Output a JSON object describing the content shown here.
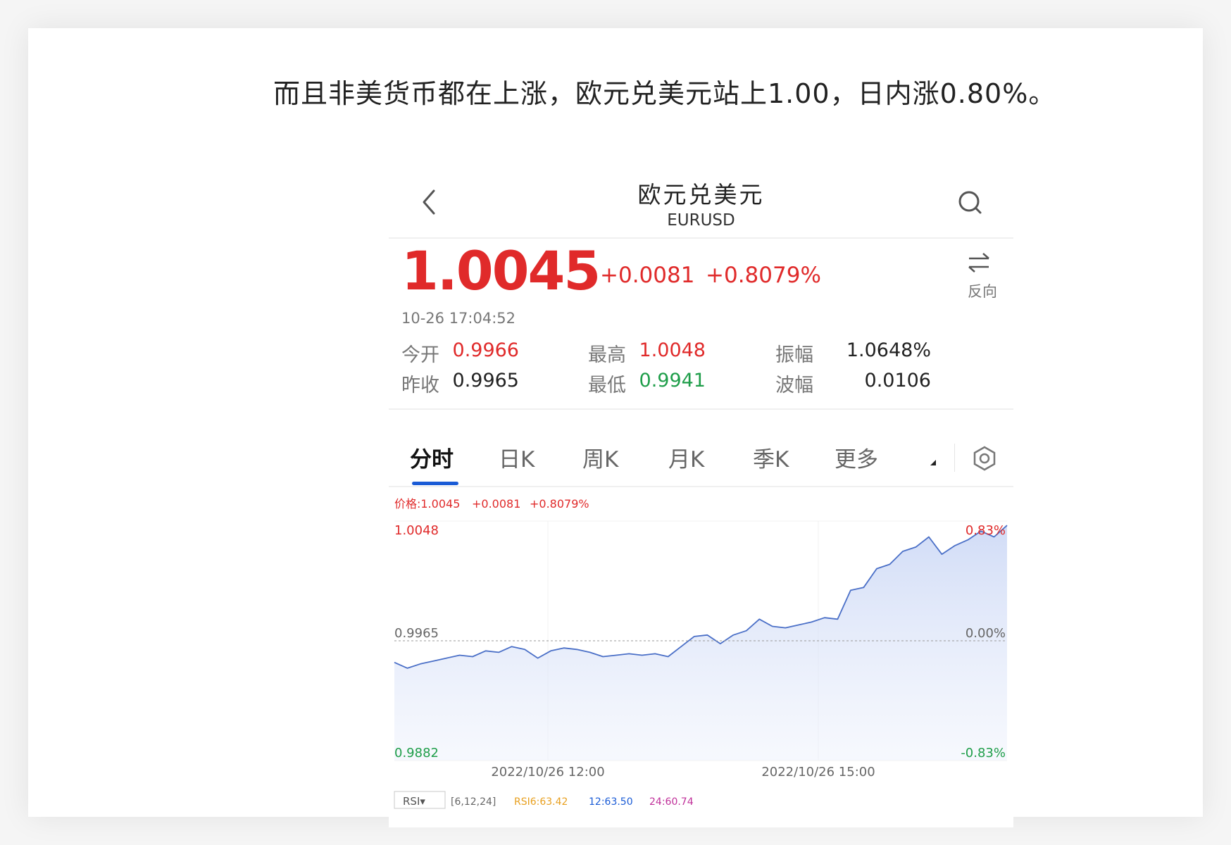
{
  "caption": "而且非美货币都在上涨，欧元兑美元站上1.00，日内涨0.80%。",
  "header": {
    "title": "欧元兑美元",
    "subtitle": "EURUSD"
  },
  "quote": {
    "price": "1.0045",
    "change": "+0.0081",
    "change_pct": "+0.8079%",
    "timestamp": "10-26 17:04:52",
    "reverse_label": "反向"
  },
  "stats": {
    "open_label": "今开",
    "open": "0.9966",
    "high_label": "最高",
    "high": "1.0048",
    "amplitude_label": "振幅",
    "amplitude": "1.0648%",
    "prev_close_label": "昨收",
    "prev_close": "0.9965",
    "low_label": "最低",
    "low": "0.9941",
    "range_label": "波幅",
    "range": "0.0106"
  },
  "tabs": [
    {
      "label": "分时",
      "active": true
    },
    {
      "label": "日K"
    },
    {
      "label": "周K"
    },
    {
      "label": "月K"
    },
    {
      "label": "季K"
    },
    {
      "label": "更多"
    }
  ],
  "colors": {
    "up": "#e02a2a",
    "down": "#1f9e4a",
    "line": "#4a6fc7",
    "accent": "#1a5bd6"
  },
  "chart": {
    "info_price": "价格:1.0045",
    "info_change": "+0.0081",
    "info_pct": "+0.8079%",
    "y_top": "1.0048",
    "y_mid": "0.9965",
    "y_bot": "0.9882",
    "pct_top": "0.83%",
    "pct_mid": "0.00%",
    "pct_bot": "-0.83%",
    "x_label_1": "2022/10/26 12:00",
    "x_label_2": "2022/10/26 15:00",
    "rsi_label": "RSI▾",
    "rsi_params": "[6,12,24]",
    "rsi_6": "RSI6:63.42",
    "rsi_12": "12:63.50",
    "rsi_24": "24:60.74"
  },
  "chart_data": {
    "type": "line",
    "title": "",
    "xlabel": "",
    "ylabel": "",
    "x_ticks": [
      "2022/10/26 12:00",
      "2022/10/26 15:00"
    ],
    "ylim": [
      0.9882,
      1.0048
    ],
    "reference": 0.9965,
    "series": [
      {
        "values": [
          0.995,
          0.9946,
          0.9949,
          0.9951,
          0.9953,
          0.9955,
          0.9954,
          0.9958,
          0.9957,
          0.9961,
          0.9959,
          0.9953,
          0.9958,
          0.996,
          0.9959,
          0.9957,
          0.9954,
          0.9955,
          0.9956,
          0.9955,
          0.9956,
          0.9954,
          0.9961,
          0.9968,
          0.9969,
          0.9963,
          0.9969,
          0.9972,
          0.998,
          0.9975,
          0.9974,
          0.9976,
          0.9978,
          0.9981,
          0.998,
          1.0,
          1.0002,
          1.0015,
          1.0018,
          1.0027,
          1.003,
          1.0037,
          1.0025,
          1.0031,
          1.0035,
          1.0041,
          1.0037,
          1.0045
        ]
      }
    ]
  }
}
